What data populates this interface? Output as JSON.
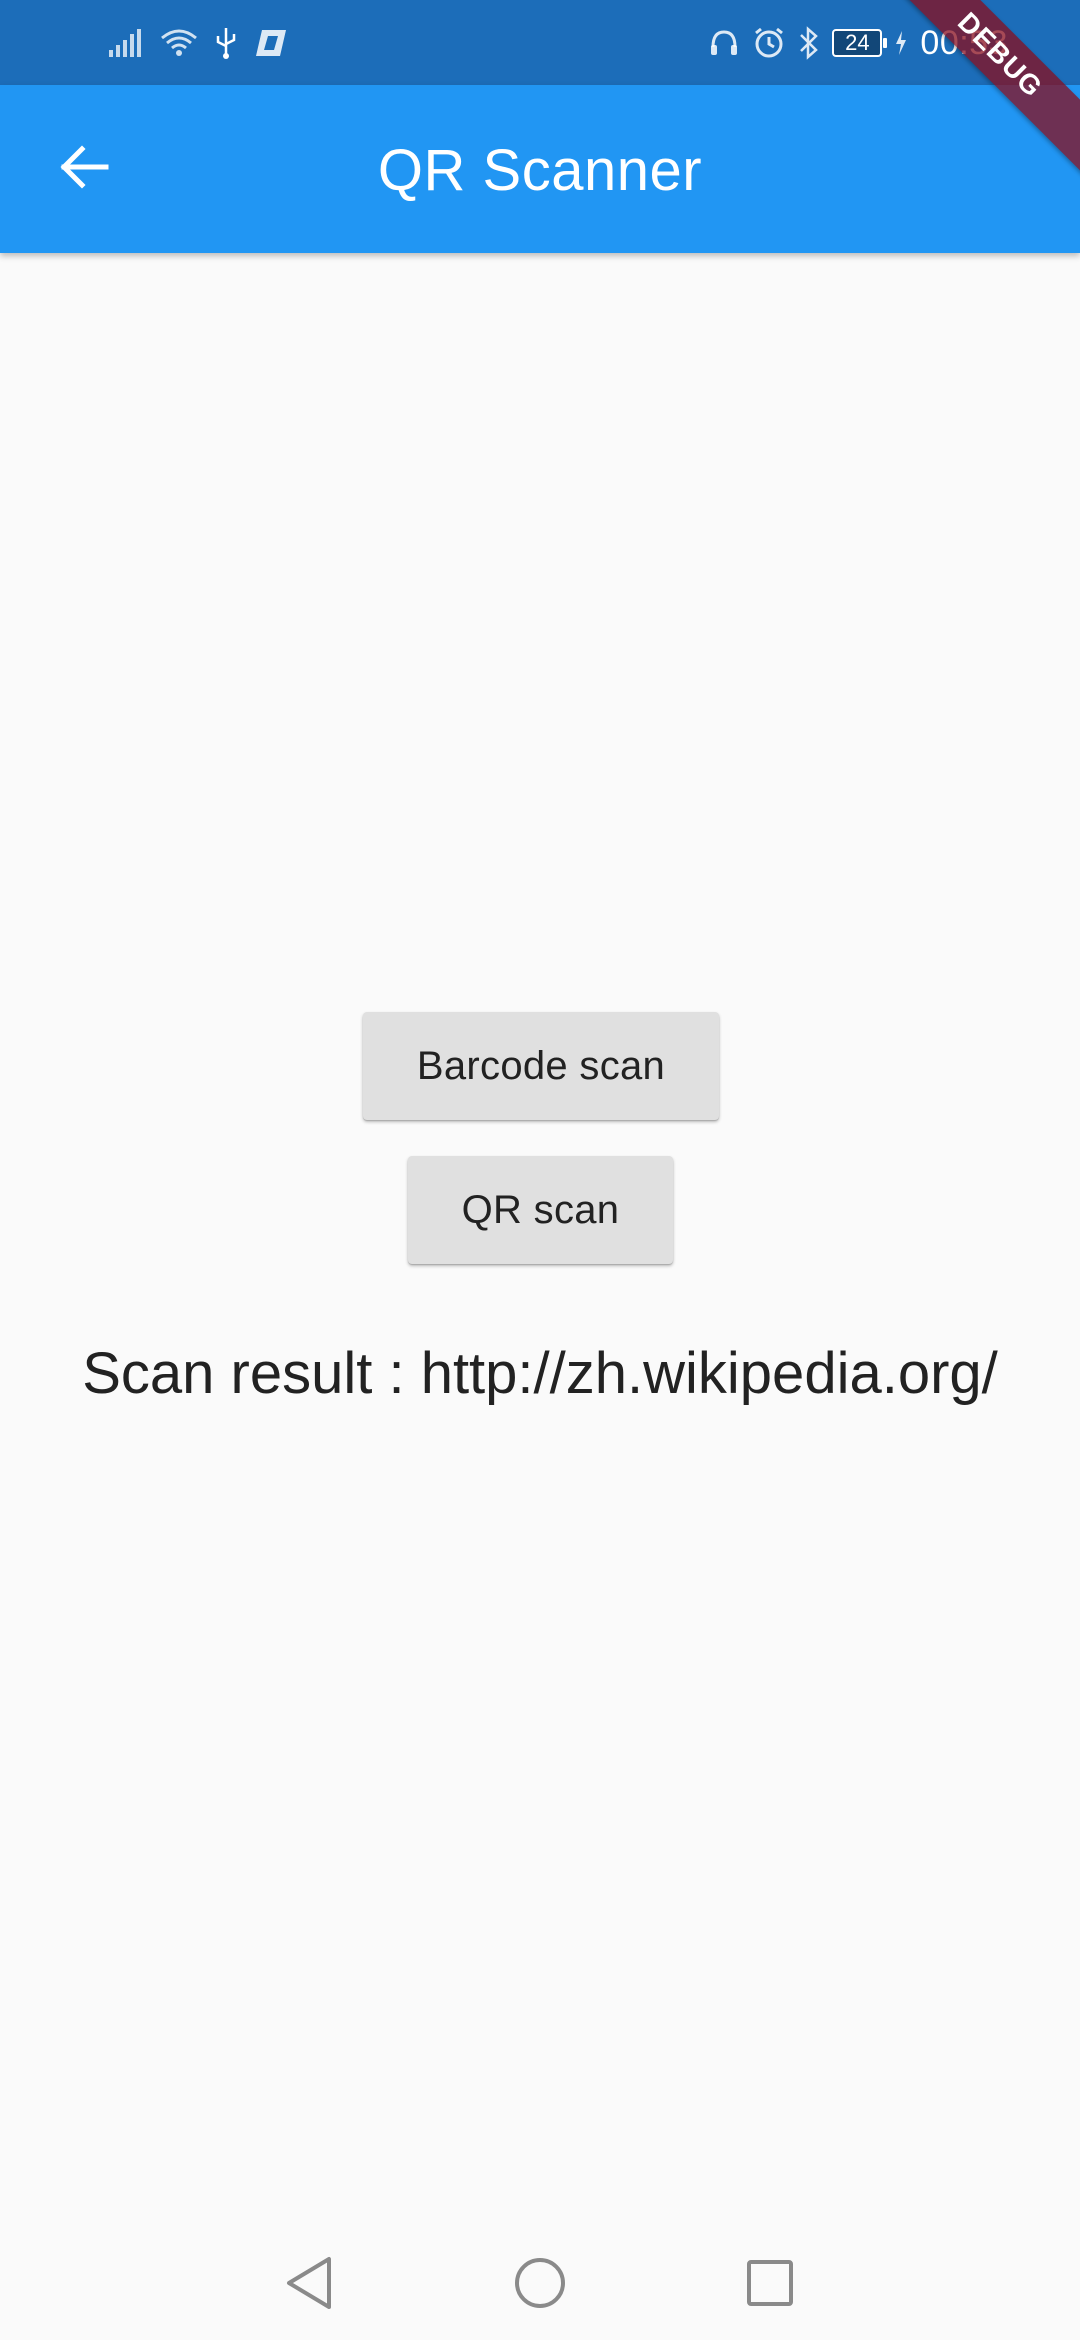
{
  "status_bar": {
    "left_icons": [
      "signal-icon",
      "wifi-icon",
      "usb-icon",
      "notification-app-icon"
    ],
    "right_icons": [
      "headphones-icon",
      "alarm-icon",
      "bluetooth-icon"
    ],
    "battery_level": "24",
    "time": "00:53",
    "background_color": "#1c6db9"
  },
  "debug_banner": {
    "label": "DEBUG"
  },
  "app_bar": {
    "title": "QR Scanner",
    "back_icon": "arrow-back-icon",
    "background_color": "#2196f3"
  },
  "main": {
    "barcode_button_label": "Barcode scan",
    "qr_button_label": "QR scan",
    "scan_result_text": "Scan result : http://zh.wikipedia.org/"
  },
  "nav_bar": {
    "buttons": [
      "back-triangle-icon",
      "home-circle-icon",
      "recent-square-icon"
    ]
  }
}
